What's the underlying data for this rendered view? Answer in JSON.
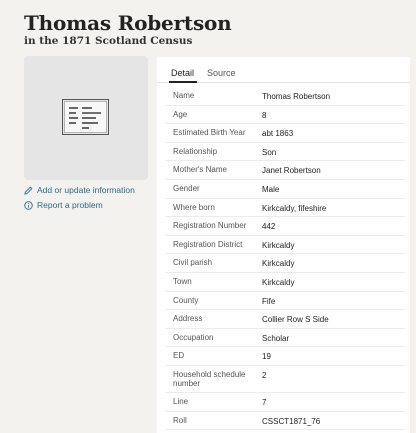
{
  "header": {
    "title": "Thomas Robertson",
    "subtitle": "in the 1871 Scotland Census"
  },
  "sidebar": {
    "add_link": "Add or update information",
    "report_link": "Report a problem"
  },
  "tabs": [
    {
      "label": "Detail",
      "active": true
    },
    {
      "label": "Source",
      "active": false
    }
  ],
  "records": [
    {
      "key": "Name",
      "value": "Thomas Robertson"
    },
    {
      "key": "Age",
      "value": "8"
    },
    {
      "key": "Estimated Birth Year",
      "value": "abt 1863"
    },
    {
      "key": "Relationship",
      "value": "Son"
    },
    {
      "key": "Mother's Name",
      "value": "Janet Robertson"
    },
    {
      "key": "Gender",
      "value": "Male"
    },
    {
      "key": "Where born",
      "value": "Kirkcaldy, fifeshire"
    },
    {
      "key": "Registration Number",
      "value": "442"
    },
    {
      "key": "Registration District",
      "value": "Kirkcaldy"
    },
    {
      "key": "Civil parish",
      "value": "Kirkcaldy"
    },
    {
      "key": "Town",
      "value": "Kirkcaldy"
    },
    {
      "key": "County",
      "value": "Fife"
    },
    {
      "key": "Address",
      "value": "Collier Row S Side"
    },
    {
      "key": "Occupation",
      "value": "Scholar"
    },
    {
      "key": "ED",
      "value": "19"
    },
    {
      "key": "Household schedule number",
      "value": "2"
    },
    {
      "key": "Line",
      "value": "7"
    },
    {
      "key": "Roll",
      "value": "CSSCT1871_76"
    }
  ],
  "colors": {
    "background": "#f4f2ee",
    "link": "#2b6b8c",
    "panel": "#ffffff"
  },
  "icons": [
    "document-icon",
    "pencil-icon",
    "info-circle-icon"
  ]
}
